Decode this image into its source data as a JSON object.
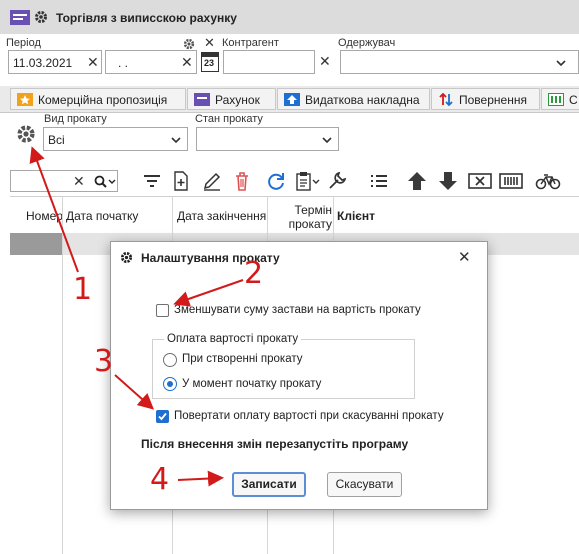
{
  "window": {
    "title": "Торгівля з виписскою рахунку"
  },
  "filters": {
    "period_label": "Період",
    "date_from": "11.03.2021",
    "date_to": ".  .",
    "calendar_day": "23",
    "counterparty_label": "Контрагент",
    "receiver_label": "Одержувач"
  },
  "tabs": [
    {
      "label": "Комерційна пропозиція"
    },
    {
      "label": "Рахунок"
    },
    {
      "label": "Видаткова накладна"
    },
    {
      "label": "Повернення"
    },
    {
      "label": "С"
    }
  ],
  "rental": {
    "type_label": "Вид прокату",
    "type_value": "Всі",
    "state_label": "Стан прокату",
    "state_value": ""
  },
  "grid": {
    "headers": [
      "Номер",
      "Дата початку",
      "Дата закінчення",
      "Термін прокату",
      "Клієнт"
    ]
  },
  "dialog": {
    "title": "Налаштування прокату",
    "reduce_deposit_label": "Зменшувати суму застави на вартість прокату",
    "reduce_deposit_checked": false,
    "payment_group_label": "Оплата вартості прокату",
    "radio_on_create": "При створенні прокату",
    "radio_on_start": "У момент початку прокату",
    "radio_selected": "on_start",
    "refund_label": "Повертати оплату вартості при скасуванні прокату",
    "refund_checked": true,
    "restart_note": "Після внесення змін перезапустіть програму",
    "save_label": "Записати",
    "cancel_label": "Скасувати"
  },
  "annotations": [
    "1",
    "2",
    "3",
    "4"
  ],
  "colors": {
    "accent": "#1e6fd0",
    "annotation": "#d21a1a"
  }
}
